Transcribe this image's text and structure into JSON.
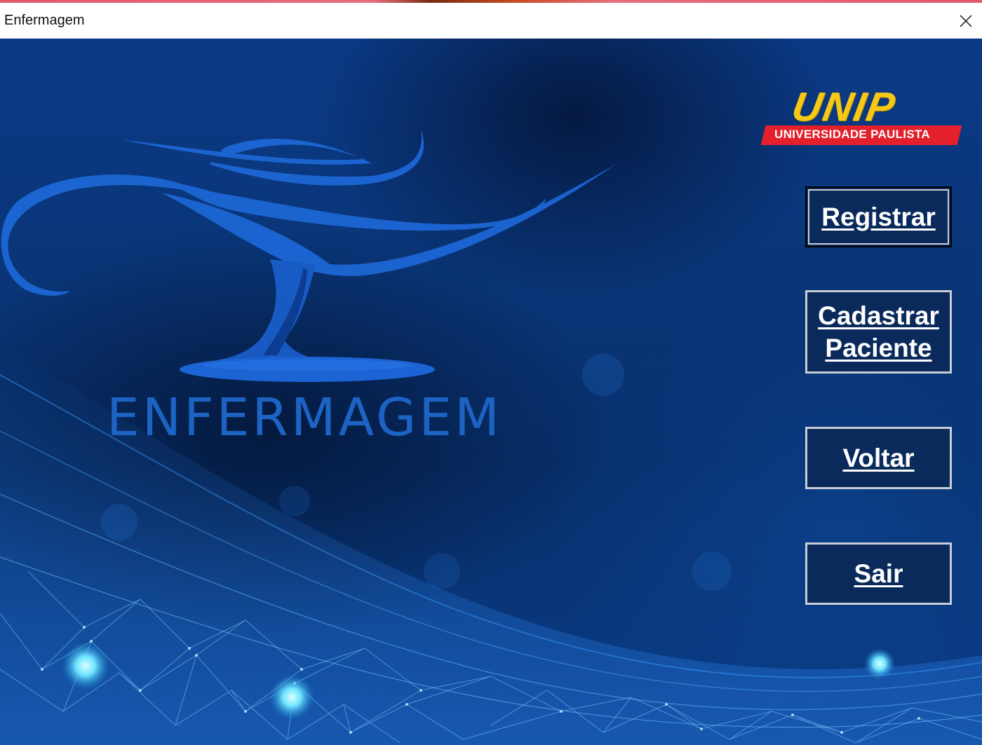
{
  "window": {
    "title": "Enfermagem",
    "close_icon": "close-icon"
  },
  "brand": {
    "logo_text": "ENFERMAGEM",
    "logo_icon": "nursing-lamp-icon",
    "university_name": "UNIP",
    "university_subtitle": "UNIVERSIDADE PAULISTA"
  },
  "buttons": {
    "registrar": "Registrar",
    "cadastrar_line1": "Cadastrar",
    "cadastrar_line2": "Paciente",
    "voltar": "Voltar",
    "sair": "Sair"
  },
  "colors": {
    "background": "#0a3577",
    "button_bg": "#0a2a5c",
    "button_text": "#ffffff",
    "logo_blue": "#1d63c4",
    "unip_yellow": "#f7c815",
    "unip_red": "#e3202c"
  }
}
